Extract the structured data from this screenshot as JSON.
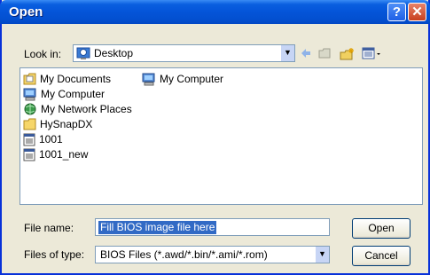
{
  "window": {
    "title": "Open"
  },
  "toolbar": {
    "look_in_label": "Look in:",
    "look_in_value": "Desktop"
  },
  "files": [
    {
      "name": "My Documents",
      "icon": "folder-docs-icon"
    },
    {
      "name": "My Computer",
      "icon": "computer-icon"
    },
    {
      "name": "My Computer",
      "icon": "computer-icon"
    },
    {
      "name": "My Network Places",
      "icon": "network-icon"
    },
    {
      "name": "HySnapDX",
      "icon": "folder-icon"
    },
    {
      "name": "1001",
      "icon": "file-icon"
    },
    {
      "name": "1001_new",
      "icon": "file-icon"
    }
  ],
  "form": {
    "file_name_label": "File name:",
    "file_name_value": "Fill BIOS image file here",
    "file_type_label": "Files of type:",
    "file_type_value": "BIOS Files (*.awd/*.bin/*.ami/*.rom)",
    "open_label": "Open",
    "cancel_label": "Cancel"
  },
  "colors": {
    "titlebar": "#0454d8",
    "dialog_bg": "#ece9d8",
    "selection": "#316ac5"
  }
}
